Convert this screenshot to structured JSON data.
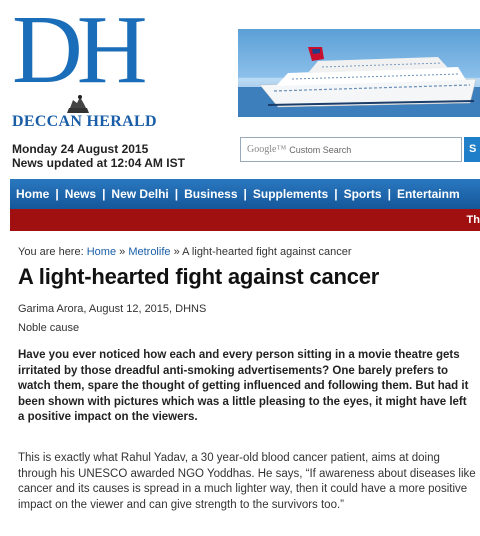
{
  "masthead": {
    "logo_text": "DH",
    "paper_name": "DECCAN HERALD",
    "date": "Monday 24 August 2015",
    "updated": "News updated at 12:04 AM IST"
  },
  "search": {
    "brand": "Google™",
    "placeholder": "Custom Search",
    "button_label": "S"
  },
  "nav": {
    "items": [
      "Home",
      "News",
      "New Delhi",
      "Business",
      "Supplements",
      "Sports",
      "Entertainm"
    ],
    "ticker_text": "Th"
  },
  "breadcrumb": {
    "prefix": "You are here:",
    "home": "Home",
    "section": "Metrolife",
    "current": "A light-hearted fight against cancer",
    "separator": "»"
  },
  "article": {
    "title": "A light-hearted fight against cancer",
    "byline": "Garima Arora, August 12, 2015, DHNS",
    "subhead": "Noble cause",
    "lead": "Have you ever noticed how each and every person sitting in a movie theatre gets irritated by those dreadful anti-smoking advertisements? One barely prefers to watch them, spare the thought of getting influenced and following them.  But had it been shown with pictures which was a little pleasing to the eyes, it might have left a positive impact on the viewers.",
    "paragraph": "This is exactly what Rahul Yadav, a 30 year-old blood cancer patient, aims at doing through his UNESCO awarded NGO Yoddhas. He says, “If awareness about diseases like cancer and its causes is spread in a much lighter way, then it could have a more positive impact on the viewer and can give strength to the survivors too.”"
  },
  "colors": {
    "brand_blue": "#1a6db8",
    "nav_blue": "#1f6ab0",
    "ticker_red": "#a11010"
  }
}
